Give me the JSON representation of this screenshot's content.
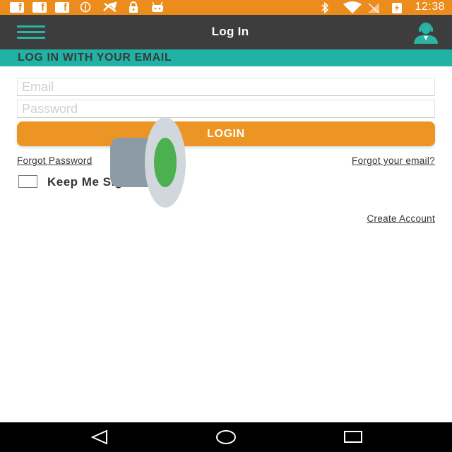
{
  "status_bar": {
    "time": "12:38",
    "left_icons": [
      "facebook-icon",
      "facebook-icon",
      "facebook-icon",
      "info-icon",
      "tools-icon",
      "lock-icon",
      "android-icon"
    ],
    "right_icons": [
      "bluetooth-icon",
      "wifi-icon",
      "no-signal-icon",
      "battery-charging-icon"
    ],
    "fb_glyph": "f"
  },
  "toolbar": {
    "title": "Log In"
  },
  "section": {
    "title": "LOG IN WITH YOUR EMAIL"
  },
  "form": {
    "email_placeholder": "Email",
    "password_placeholder": "Password",
    "login_label": "LOGIN",
    "forgot_password": "Forgot Password",
    "forgot_email": "Forgot your email?",
    "keep_signed_in": "Keep Me Signed In",
    "create_account": "Create Account"
  },
  "colors": {
    "status_bar": "#ec8c1c",
    "toolbar": "#3d3d3d",
    "accent": "#20b3a5",
    "button": "#ed9524"
  }
}
